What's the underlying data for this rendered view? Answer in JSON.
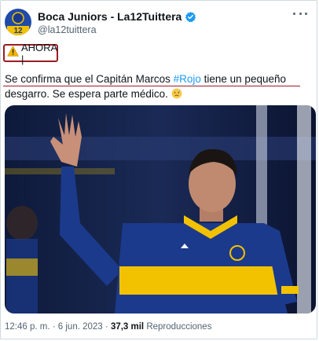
{
  "header": {
    "display_name": "Boca Juniors - La12Tuittera",
    "handle": "@la12tuittera",
    "avatar_text": "12"
  },
  "tweet": {
    "badge_emoji": "⚠️",
    "badge_text": "AHORA |",
    "text_before": "Se confirma que el Capitán Marcos ",
    "hashtag": "#Rojo",
    "text_after": " tiene un pequeño desgarro. Se espera parte médico. ",
    "trailing_emoji": "😓"
  },
  "meta": {
    "time": "12:46 p. m.",
    "separator1": " · ",
    "date": "6 jun. 2023",
    "separator2": " · ",
    "views": "37,3 mil",
    "views_label": " Reproducciones"
  },
  "photo": {
    "jersey_colors": {
      "blue": "#1c3a8c",
      "yellow": "#f2c200"
    }
  }
}
